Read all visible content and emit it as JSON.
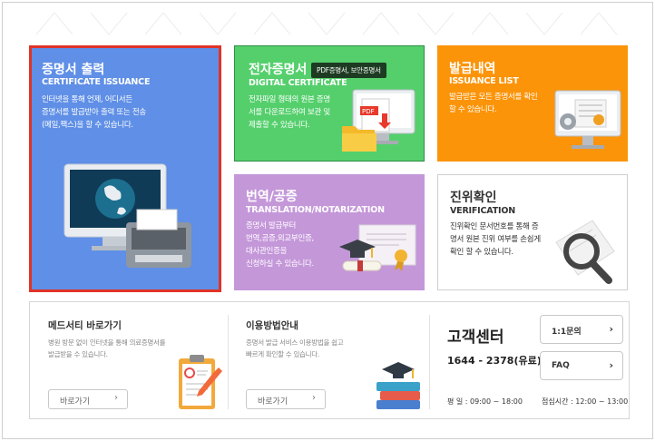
{
  "tiles": {
    "certificate": {
      "title": "증명서 출력",
      "subtitle": "CERTIFICATE ISSUANCE",
      "desc1": "인터넷을 통해 언제, 어디서든",
      "desc2": "증명서를 발급받아 출력 또는 전송",
      "desc3": "(메일,팩스)을 할 수 있습니다."
    },
    "digital": {
      "title": "전자증명서",
      "badge": "PDF증명서, 보안증명서",
      "subtitle": "DIGITAL CERTIFICATE",
      "desc1": "전자파일 형태의 원본 증명",
      "desc2": "서를 다운로드하여 보관 및",
      "desc3": "제출할 수 있습니다."
    },
    "issuance": {
      "title": "발급내역",
      "subtitle": "ISSUANCE LIST",
      "desc1": "발급받은 모든 증명서를 확인",
      "desc2": "할 수 있습니다."
    },
    "translation": {
      "title": "번역/공증",
      "subtitle": "TRANSLATION/NOTARIZATION",
      "desc1": "증명서 발급부터",
      "desc2": "번역,공증,외교부인증,",
      "desc3": "대사관인증을",
      "desc4": "신청하실 수 있습니다."
    },
    "verification": {
      "title": "진위확인",
      "subtitle": "VERIFICATION",
      "desc1": "진위확인 문서번호를 통해 증",
      "desc2": "명서 원본 진위 여부를 손쉽게",
      "desc3": "확인 할 수 있습니다."
    }
  },
  "bottom": {
    "medicity": {
      "title": "메드서티 바로가기",
      "desc1": "병원 방문 없이 인터넷을 통해 의료증명서를",
      "desc2": "발급받을 수 있습니다.",
      "button": "바로가기"
    },
    "guide": {
      "title": "이용방법안내",
      "desc1": "증명서 발급 서비스 이용방법을 쉽고",
      "desc2": "빠르게 확인할 수 있습니다.",
      "button": "바로가기"
    },
    "support": {
      "title": "고객센터",
      "phone": "1644 - 2378(유료)",
      "hours_label": "평     일 : 09:00 ~ 18:00",
      "lunch_label": "점심시간 : 12:00 ~ 13:00",
      "inquiry_button": "1:1문의",
      "faq_button": "FAQ"
    }
  },
  "icons": {
    "certificate": "monitor-printer-icon",
    "digital": "pdf-monitor-icon",
    "issuance": "list-monitor-icon",
    "translation": "diploma-icon",
    "verification": "magnifier-icon",
    "medicity": "clipboard-icon",
    "guide": "books-icon",
    "chevron": "›"
  },
  "colors": {
    "certificate": "#5f8fe6",
    "highlight_border": "#e03327",
    "digital": "#54cf6c",
    "issuance": "#fb9409",
    "translation": "#c497d9"
  }
}
